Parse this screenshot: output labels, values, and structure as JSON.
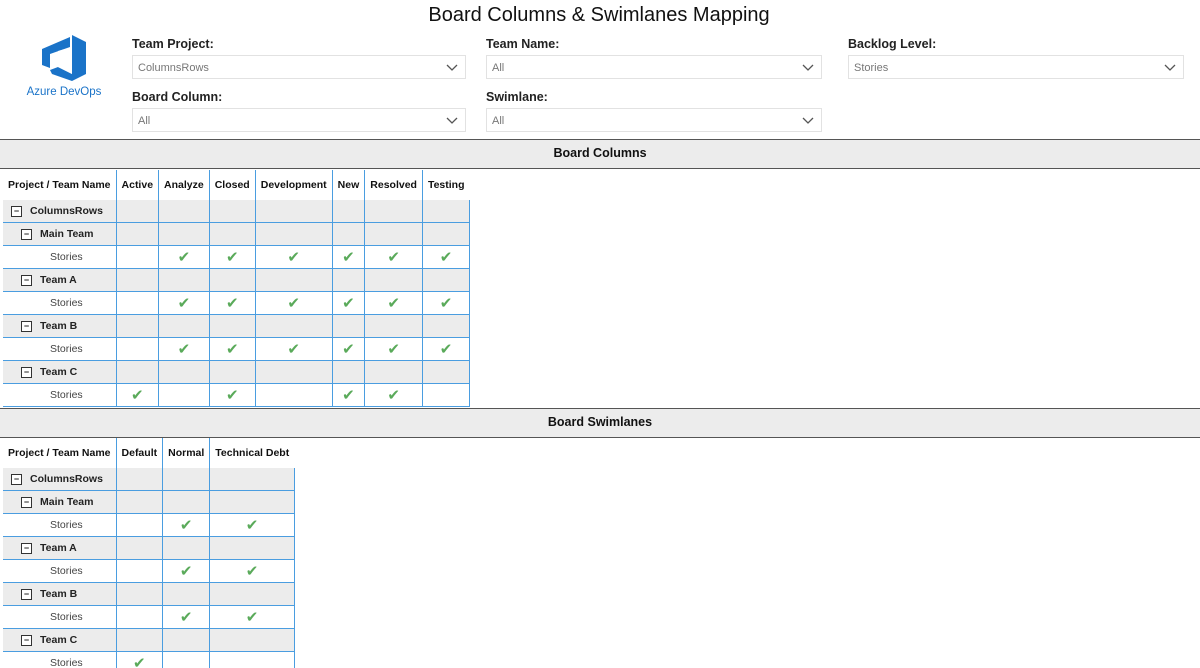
{
  "title": "Board Columns & Swimlanes Mapping",
  "logo": {
    "text": "Azure DevOps",
    "icon": "azure-devops-logo",
    "color": "#1a73c8"
  },
  "filters": {
    "team_project": {
      "label": "Team Project:",
      "value": "ColumnsRows"
    },
    "team_name": {
      "label": "Team Name:",
      "value": "All"
    },
    "backlog_level": {
      "label": "Backlog Level:",
      "value": "Stories"
    },
    "board_column": {
      "label": "Board Column:",
      "value": "All"
    },
    "swimlane": {
      "label": "Swimlane:",
      "value": "All"
    }
  },
  "board_columns": {
    "title": "Board Columns",
    "headers": [
      "Project / Team Name",
      "Active",
      "Analyze",
      "Closed",
      "Development",
      "New",
      "Resolved",
      "Testing"
    ],
    "rows": [
      {
        "label": "ColumnsRows",
        "level": 0,
        "toggle": "−",
        "cells": [
          "",
          "",
          "",
          "",
          "",
          "",
          ""
        ]
      },
      {
        "label": "Main Team",
        "level": 1,
        "toggle": "−",
        "cells": [
          "",
          "",
          "",
          "",
          "",
          "",
          ""
        ]
      },
      {
        "label": "Stories",
        "level": 2,
        "cells": [
          "",
          "✔",
          "✔",
          "✔",
          "✔",
          "✔",
          "✔"
        ]
      },
      {
        "label": "Team A",
        "level": 1,
        "toggle": "−",
        "cells": [
          "",
          "",
          "",
          "",
          "",
          "",
          ""
        ]
      },
      {
        "label": "Stories",
        "level": 2,
        "cells": [
          "",
          "✔",
          "✔",
          "✔",
          "✔",
          "✔",
          "✔"
        ]
      },
      {
        "label": "Team B",
        "level": 1,
        "toggle": "−",
        "cells": [
          "",
          "",
          "",
          "",
          "",
          "",
          ""
        ]
      },
      {
        "label": "Stories",
        "level": 2,
        "cells": [
          "",
          "✔",
          "✔",
          "✔",
          "✔",
          "✔",
          "✔"
        ]
      },
      {
        "label": "Team C",
        "level": 1,
        "toggle": "−",
        "cells": [
          "",
          "",
          "",
          "",
          "",
          "",
          ""
        ]
      },
      {
        "label": "Stories",
        "level": 2,
        "cells": [
          "✔",
          "",
          "✔",
          "",
          "✔",
          "✔",
          ""
        ]
      }
    ]
  },
  "board_swimlanes": {
    "title": "Board Swimlanes",
    "headers": [
      "Project / Team Name",
      "Default",
      "Normal",
      "Technical Debt"
    ],
    "rows": [
      {
        "label": "ColumnsRows",
        "level": 0,
        "toggle": "−",
        "cells": [
          "",
          "",
          ""
        ]
      },
      {
        "label": "Main Team",
        "level": 1,
        "toggle": "−",
        "cells": [
          "",
          "",
          ""
        ]
      },
      {
        "label": "Stories",
        "level": 2,
        "cells": [
          "",
          "✔",
          "✔"
        ]
      },
      {
        "label": "Team A",
        "level": 1,
        "toggle": "−",
        "cells": [
          "",
          "",
          ""
        ]
      },
      {
        "label": "Stories",
        "level": 2,
        "cells": [
          "",
          "✔",
          "✔"
        ]
      },
      {
        "label": "Team B",
        "level": 1,
        "toggle": "−",
        "cells": [
          "",
          "",
          ""
        ]
      },
      {
        "label": "Stories",
        "level": 2,
        "cells": [
          "",
          "✔",
          "✔"
        ]
      },
      {
        "label": "Team C",
        "level": 1,
        "toggle": "−",
        "cells": [
          "",
          "",
          ""
        ]
      },
      {
        "label": "Stories",
        "level": 2,
        "cells": [
          "✔",
          "",
          ""
        ]
      }
    ]
  },
  "colors": {
    "accent": "#1a73c8",
    "check": "#5aaa5a",
    "grid": "#4a9de0",
    "shade": "#ececec"
  }
}
